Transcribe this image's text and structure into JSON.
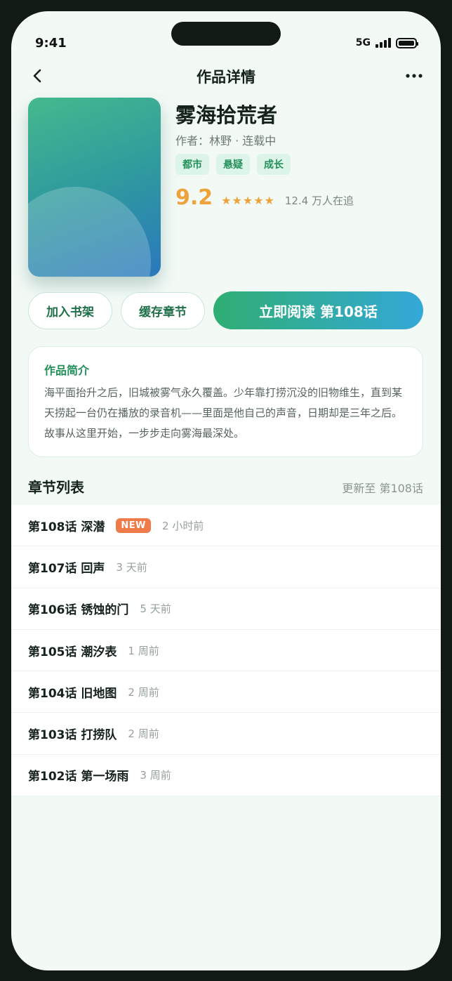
{
  "status": {
    "time": "9:41",
    "network": "5G"
  },
  "nav": {
    "title": "作品详情"
  },
  "book": {
    "title": "雾海拾荒者",
    "meta": "作者：林野 · 连载中",
    "tags": [
      "都市",
      "悬疑",
      "成长"
    ],
    "score": "9.2",
    "stars": "★★★★★",
    "followers": "12.4 万人在追"
  },
  "actions": {
    "shelf": "加入书架",
    "cache": "缓存章节",
    "read": "立即阅读 第108话"
  },
  "intro": {
    "title": "作品简介",
    "text": "海平面抬升之后，旧城被雾气永久覆盖。少年靠打捞沉没的旧物维生，直到某天捞起一台仍在播放的录音机——里面是他自己的声音，日期却是三年之后。故事从这里开始，一步步走向雾海最深处。"
  },
  "chapters": {
    "title": "章节列表",
    "update": "更新至 第108话",
    "new_label": "NEW",
    "items": [
      {
        "name": "第108话 深潜",
        "time": "2 小时前"
      },
      {
        "name": "第107话 回声",
        "time": "3 天前"
      },
      {
        "name": "第106话 锈蚀的门",
        "time": "5 天前"
      },
      {
        "name": "第105话 潮汐表",
        "time": "1 周前"
      },
      {
        "name": "第104话 旧地图",
        "time": "2 周前"
      },
      {
        "name": "第103话 打捞队",
        "time": "2 周前"
      },
      {
        "name": "第102话 第一场雨",
        "time": "3 周前"
      }
    ]
  },
  "colors": {
    "accent": "#23905a",
    "score": "#eea23a",
    "badge": "#ef7b4b",
    "background": "#f3faf6"
  },
  "icons": {
    "back": "chevron-left-icon",
    "more": "more-horizontal-icon"
  }
}
